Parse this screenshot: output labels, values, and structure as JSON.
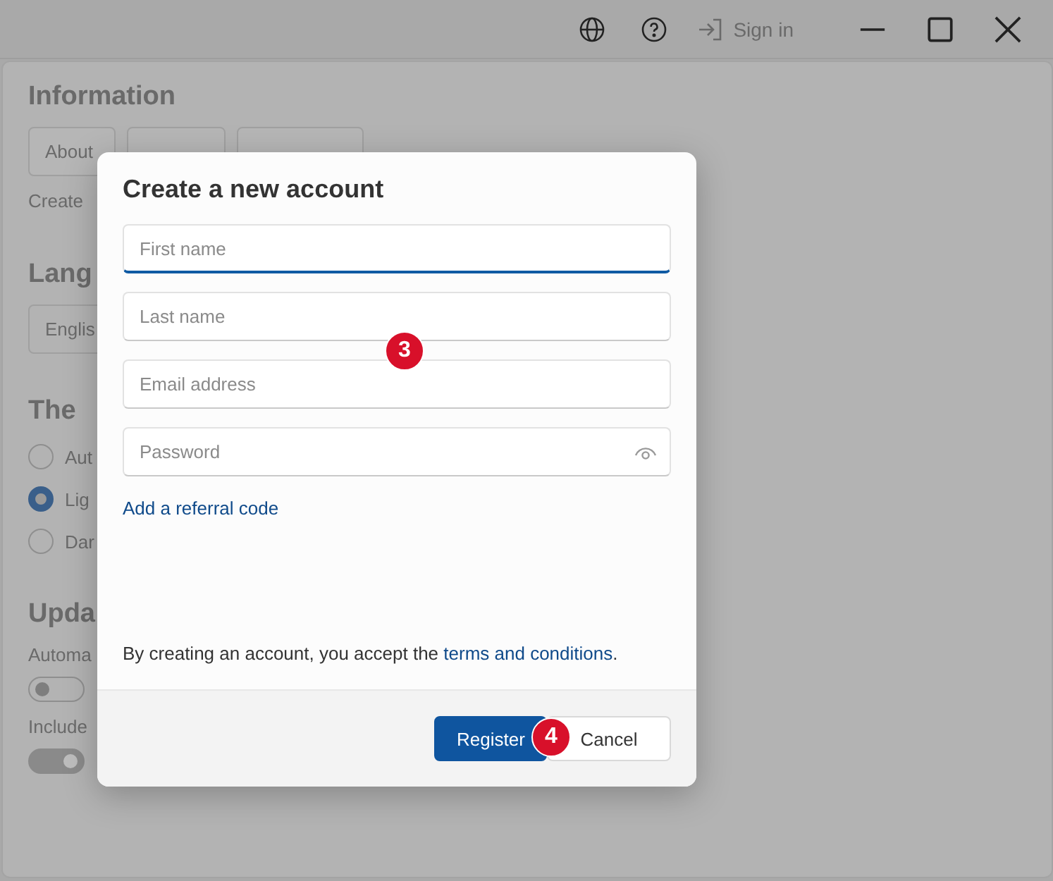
{
  "title_bar": {
    "sign_in": "Sign in"
  },
  "background": {
    "information": {
      "heading": "Information",
      "buttons": [
        "About"
      ],
      "text": "Create"
    },
    "language": {
      "heading": "Lang",
      "value": "Englis"
    },
    "theme": {
      "heading": "The",
      "options": [
        {
          "label": "Aut",
          "selected": false
        },
        {
          "label": "Lig",
          "selected": true
        },
        {
          "label": "Dar",
          "selected": false
        }
      ]
    },
    "updates": {
      "heading": "Upda",
      "toggles": [
        {
          "label": "Automa",
          "on": false
        },
        {
          "label": "Include",
          "on": true
        }
      ]
    }
  },
  "dialog": {
    "title": "Create a new account",
    "fields": [
      {
        "placeholder": "First name",
        "focused": true
      },
      {
        "placeholder": "Last name",
        "focused": false
      },
      {
        "placeholder": "Email address",
        "focused": false
      },
      {
        "placeholder": "Password",
        "focused": false,
        "kind": "password"
      }
    ],
    "referral_link": "Add a referral code",
    "terms_text": "By creating an account, you accept the",
    "terms_link": "terms and conditions",
    "terms_end": ".",
    "buttons": [
      {
        "label": "Register",
        "kind": "primary"
      },
      {
        "label": "Cancel",
        "kind": "secondary"
      }
    ]
  },
  "markers": [
    "3",
    "4"
  ]
}
